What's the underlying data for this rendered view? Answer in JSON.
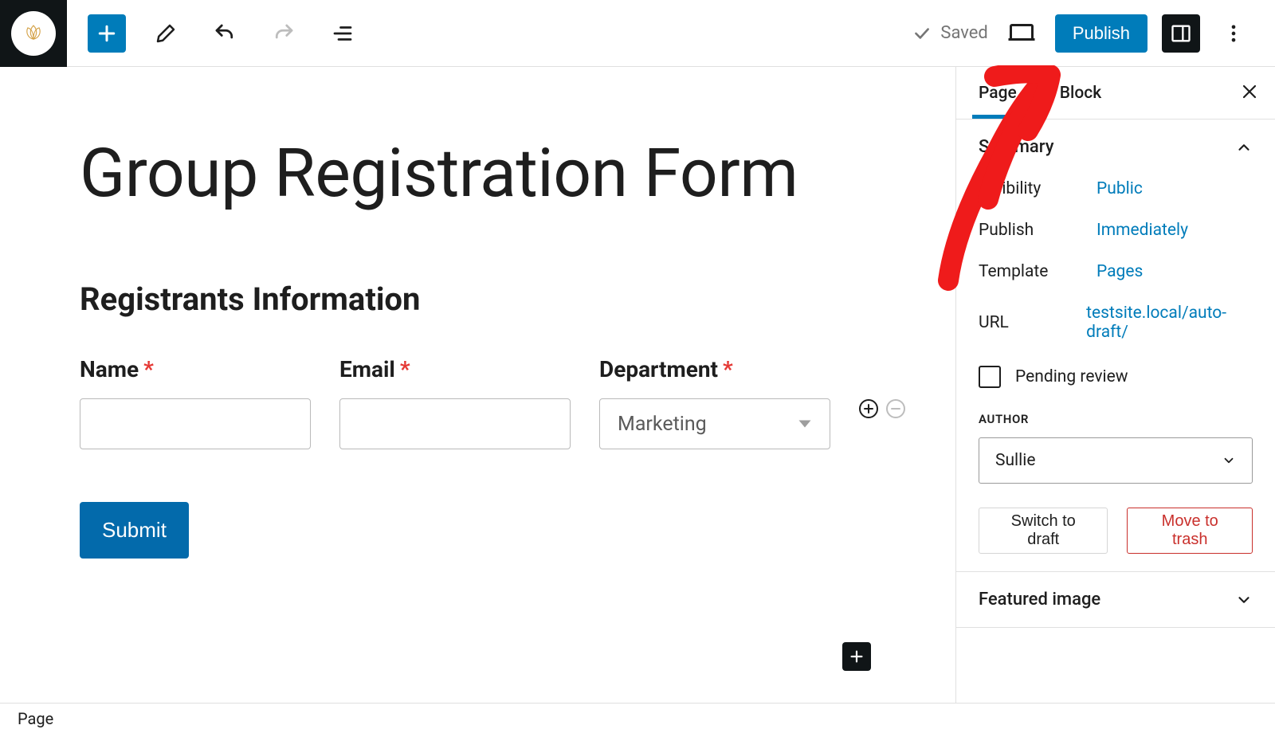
{
  "topbar": {
    "saved_label": "Saved",
    "publish_label": "Publish"
  },
  "canvas": {
    "page_title": "Group Registration Form",
    "section_heading": "Registrants Information",
    "fields": {
      "name_label": "Name",
      "email_label": "Email",
      "department_label": "Department",
      "department_value": "Marketing"
    },
    "submit_label": "Submit"
  },
  "panel": {
    "tabs": {
      "page": "Page",
      "block": "Block"
    },
    "summary_heading": "Summary",
    "visibility": {
      "label": "Visibility",
      "value": "Public"
    },
    "publish": {
      "label": "Publish",
      "value": "Immediately"
    },
    "template": {
      "label": "Template",
      "value": "Pages"
    },
    "url": {
      "label": "URL",
      "value": "testsite.local/auto-draft/"
    },
    "pending_review_label": "Pending review",
    "author_heading": "AUTHOR",
    "author_value": "Sullie",
    "switch_to_draft": "Switch to draft",
    "move_to_trash": "Move to trash",
    "featured_image": "Featured image"
  },
  "statusbar": {
    "breadcrumb": "Page"
  }
}
